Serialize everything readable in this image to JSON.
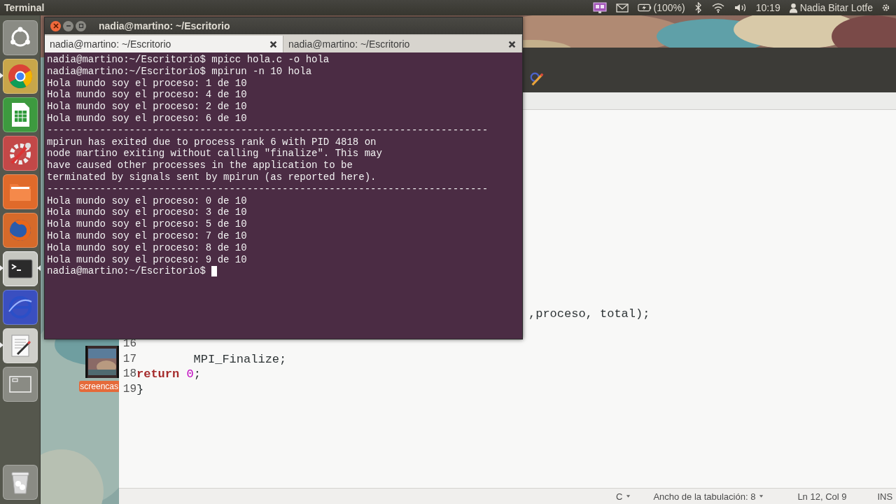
{
  "top_panel": {
    "app_title": "Terminal",
    "battery": "(100%)",
    "clock": "10:19",
    "user": "Nadia Bitar Lotfe"
  },
  "launcher": [
    {
      "kind": "dash",
      "running": false,
      "selected": false
    },
    {
      "kind": "chrome",
      "running": true,
      "selected": false
    },
    {
      "kind": "spreadsheet",
      "running": false,
      "selected": false
    },
    {
      "kind": "tools",
      "running": false,
      "selected": false
    },
    {
      "kind": "files",
      "running": false,
      "selected": false
    },
    {
      "kind": "firefox",
      "running": false,
      "selected": false
    },
    {
      "kind": "terminal",
      "running": true,
      "selected": true
    },
    {
      "kind": "browser",
      "running": false,
      "selected": false
    },
    {
      "kind": "editor",
      "running": true,
      "selected": false
    },
    {
      "kind": "workspaces",
      "running": false,
      "selected": false
    },
    {
      "kind": "trash",
      "running": false,
      "selected": false
    }
  ],
  "desktop_icons": [
    {
      "label": "screencas"
    }
  ],
  "editor": {
    "lines": [
      {
        "kind": "tail",
        "segments": [
          {
            "kind": "plain",
            "text": ",proceso, total);"
          }
        ]
      },
      {
        "kind": "full",
        "number": "16"
      },
      {
        "kind": "full",
        "number": "17",
        "segments": [
          {
            "kind": "plain",
            "text": "        MPI_Finalize;"
          }
        ]
      },
      {
        "kind": "full",
        "number": "18",
        "segments": [
          {
            "kind": "keyword",
            "text": "return "
          },
          {
            "kind": "number",
            "text": "0"
          },
          {
            "kind": "plain",
            "text": ";"
          }
        ]
      },
      {
        "kind": "full",
        "number": "19",
        "segments": [
          {
            "kind": "plain",
            "text": "}"
          }
        ]
      }
    ],
    "status_bar": {
      "language": "C",
      "tab_width": "Ancho de la tabulación: 8",
      "position": "Ln 12, Col 9",
      "mode": "INS"
    }
  },
  "terminal": {
    "title": "nadia@martino: ~/Escritorio",
    "tabs": [
      {
        "label": "nadia@martino: ~/Escritorio",
        "selected": true
      },
      {
        "label": "nadia@martino: ~/Escritorio",
        "selected": false
      }
    ],
    "lines": [
      "nadia@martino:~/Escritorio$ mpicc hola.c -o hola",
      "nadia@martino:~/Escritorio$ mpirun -n 10 hola",
      "Hola mundo soy el proceso: 1 de 10",
      "Hola mundo soy el proceso: 4 de 10",
      "Hola mundo soy el proceso: 2 de 10",
      "Hola mundo soy el proceso: 6 de 10",
      "---------------------------------------------------------------------------",
      "mpirun has exited due to process rank 6 with PID 4818 on",
      "node martino exiting without calling \"finalize\". This may",
      "have caused other processes in the application to be",
      "terminated by signals sent by mpirun (as reported here).",
      "---------------------------------------------------------------------------",
      "Hola mundo soy el proceso: 0 de 10",
      "Hola mundo soy el proceso: 3 de 10",
      "Hola mundo soy el proceso: 5 de 10",
      "Hola mundo soy el proceso: 7 de 10",
      "Hola mundo soy el proceso: 8 de 10",
      "Hola mundo soy el proceso: 9 de 10",
      "nadia@martino:~/Escritorio$ "
    ],
    "cursor": true
  }
}
